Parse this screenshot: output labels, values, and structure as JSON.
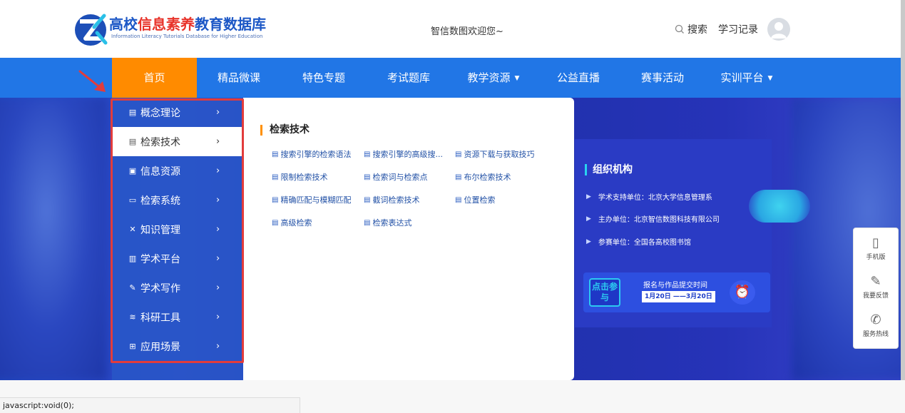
{
  "header": {
    "logo_title_part1": "高校",
    "logo_title_part2": "信息素养",
    "logo_title_part3": "教育数据库",
    "logo_subtitle": "Information Literacy Tutorials Database for Higher Education",
    "welcome": "智信数图欢迎您~",
    "search_label": "搜索",
    "study_record": "学习记录"
  },
  "nav": {
    "items": [
      {
        "label": "首页",
        "active": true
      },
      {
        "label": "精品微课"
      },
      {
        "label": "特色专题"
      },
      {
        "label": "考试题库"
      },
      {
        "label": "教学资源",
        "caret": "▼"
      },
      {
        "label": "公益直播"
      },
      {
        "label": "赛事活动"
      },
      {
        "label": "实训平台",
        "caret": "▼"
      }
    ]
  },
  "menu": {
    "items": [
      {
        "label": "概念理论",
        "icon": "document-icon"
      },
      {
        "label": "检索技术",
        "icon": "search-doc-icon",
        "active": true
      },
      {
        "label": "信息资源",
        "icon": "resource-icon"
      },
      {
        "label": "检索系统",
        "icon": "system-icon"
      },
      {
        "label": "知识管理",
        "icon": "tools-icon"
      },
      {
        "label": "学术平台",
        "icon": "platform-icon"
      },
      {
        "label": "学术写作",
        "icon": "writing-icon"
      },
      {
        "label": "科研工具",
        "icon": "layers-icon"
      },
      {
        "label": "应用场景",
        "icon": "grid-icon"
      }
    ],
    "arrow": "›"
  },
  "panel": {
    "title": "检索技术",
    "links": [
      "搜索引擎的检索语法",
      "搜索引擎的高级搜...",
      "资源下载与获取技巧",
      "限制检索技术",
      "检索词与检索点",
      "布尔检索技术",
      "精确匹配与模糊匹配",
      "截词检索技术",
      "位置检索",
      "高级检索",
      "检索表达式"
    ]
  },
  "banner": {
    "card_title": "组织机构",
    "lines": [
      "学术支持单位：北京大学信息管理系",
      "主办单位：北京智信数图科技有限公司",
      "参赛单位：全国各高校图书馆"
    ],
    "cta_button": "点击参与",
    "cta_title": "报名与作品提交时间",
    "cta_date": "1月20日 ——3月20日"
  },
  "side": {
    "mobile": "手机版",
    "feedback": "我要反馈",
    "hotline": "服务热线"
  },
  "status_bar": "javascript:void(0);"
}
